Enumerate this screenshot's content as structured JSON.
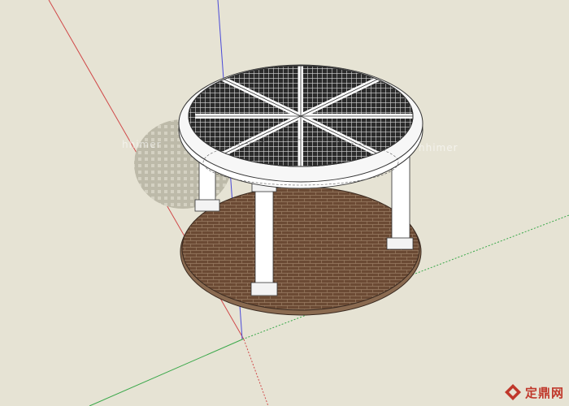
{
  "viewport": {
    "background_color": "#e6e3d4",
    "axis_colors": {
      "red": "#d04a4a",
      "green": "#3aa84a",
      "blue": "#4a4ad8"
    }
  },
  "model": {
    "column_color": "#ffffff",
    "floor_color": "#6b4a34",
    "floor_mortar_color": "#9a7d63",
    "shadow_color": "#bdbaa9"
  },
  "watermarks": {
    "left": "hhimer",
    "right": "hhimer"
  },
  "logo": {
    "text": "定鼎网",
    "color": "#c0382b"
  }
}
